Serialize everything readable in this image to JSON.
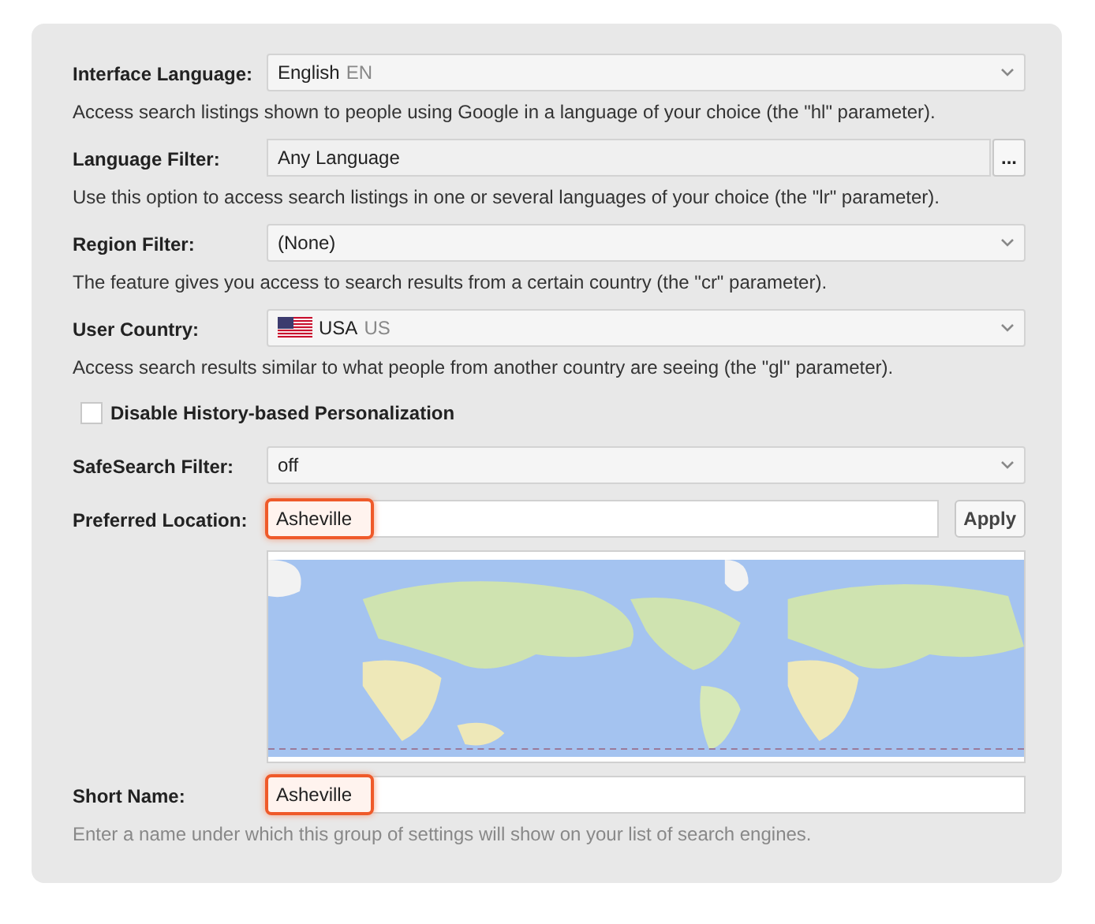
{
  "fields": [
    {
      "kind": "select",
      "label": "Interface Language:",
      "value": "English",
      "code": "EN",
      "description": "Access search listings shown to people using Google in a language of your choice (the \"hl\" parameter).",
      "muted": false
    },
    {
      "kind": "picker",
      "label": "Language Filter:",
      "value": "Any Language",
      "button": "...",
      "description": "Use this option to access search listings in one or several languages of your choice (the \"lr\" parameter).",
      "muted": false
    },
    {
      "kind": "select",
      "label": "Region Filter:",
      "value": "(None)",
      "description": "The feature gives you access to search results from a certain country (the \"cr\" parameter).",
      "muted": false
    },
    {
      "kind": "select",
      "label": "User Country:",
      "flag": true,
      "value": "USA",
      "code": "US",
      "description": "Access search results similar to what people from another country are seeing (the \"gl\" parameter).",
      "muted": false
    },
    {
      "kind": "checkbox",
      "label": "Disable History-based Personalization",
      "checked": false
    },
    {
      "kind": "select",
      "label": "SafeSearch Filter:",
      "value": "off"
    },
    {
      "kind": "location",
      "label": "Preferred Location:",
      "value": "Asheville",
      "highlighted": true,
      "button": "Apply"
    },
    {
      "kind": "text",
      "label": "Short Name:",
      "value": "Asheville",
      "highlighted": true,
      "description": "Enter a name under which this group of settings will show on your list of search engines.",
      "muted": true
    }
  ]
}
